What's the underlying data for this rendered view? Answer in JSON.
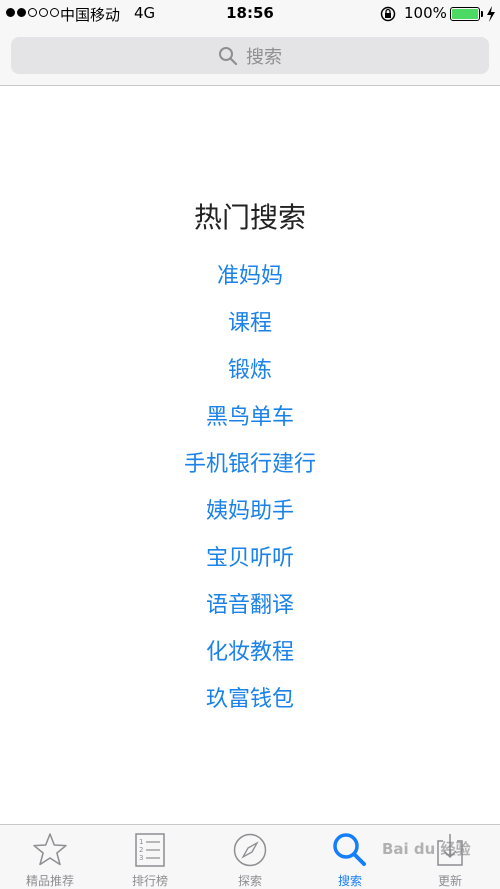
{
  "status_bar": {
    "carrier": "中国移动",
    "network": "4G",
    "time": "18:56",
    "battery": "100%"
  },
  "search": {
    "placeholder": "搜索"
  },
  "hot_searches": {
    "title": "热门搜索",
    "items": [
      "准妈妈",
      "课程",
      "锻炼",
      "黑鸟单车",
      "手机银行建行",
      "姨妈助手",
      "宝贝听听",
      "语音翻译",
      "化妆教程",
      "玖富钱包"
    ]
  },
  "tab_bar": {
    "tabs": [
      {
        "label": "精品推荐",
        "icon": "star-icon"
      },
      {
        "label": "排行榜",
        "icon": "list-icon"
      },
      {
        "label": "探索",
        "icon": "compass-icon"
      },
      {
        "label": "搜索",
        "icon": "search-icon"
      },
      {
        "label": "更新",
        "icon": "download-icon"
      }
    ],
    "active_index": 3
  },
  "watermark": "Bai du 经验",
  "colors": {
    "accent": "#147efb",
    "link": "#1a82e8",
    "battery": "#4cd964"
  }
}
